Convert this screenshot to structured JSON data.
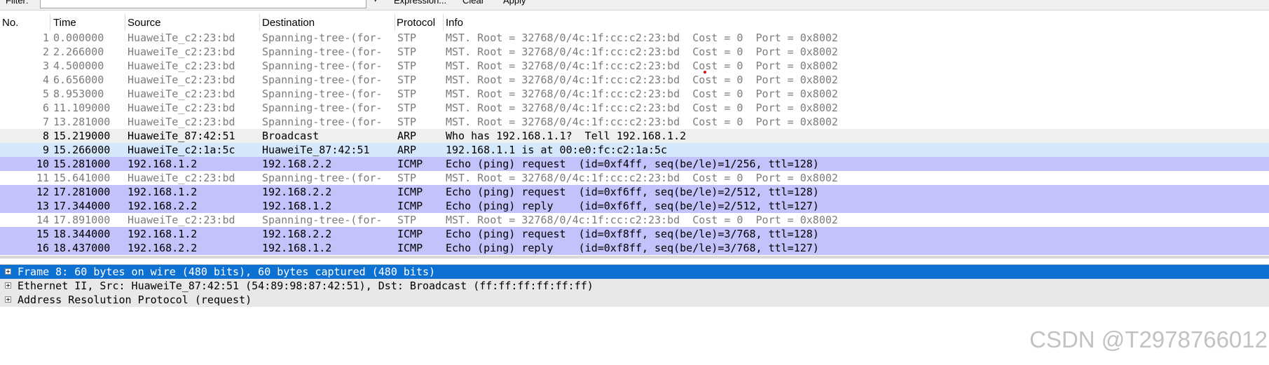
{
  "filter": {
    "label": "Filter:",
    "value": "",
    "expression_label": "Expression...",
    "clear_label": "Clear",
    "apply_label": "Apply"
  },
  "columns": [
    "No.",
    "Time",
    "Source",
    "Destination",
    "Protocol",
    "Info"
  ],
  "packets": [
    {
      "no": "1",
      "time": "0.000000",
      "source": "HuaweiTe_c2:23:bd",
      "destination": "Spanning-tree-(for-",
      "protocol": "STP",
      "info": "MST. Root = 32768/0/4c:1f:cc:c2:23:bd  Cost = 0  Port = 0x8002",
      "kind": "stp"
    },
    {
      "no": "2",
      "time": "2.266000",
      "source": "HuaweiTe_c2:23:bd",
      "destination": "Spanning-tree-(for-",
      "protocol": "STP",
      "info": "MST. Root = 32768/0/4c:1f:cc:c2:23:bd  Cost = 0  Port = 0x8002",
      "kind": "stp"
    },
    {
      "no": "3",
      "time": "4.500000",
      "source": "HuaweiTe_c2:23:bd",
      "destination": "Spanning-tree-(for-",
      "protocol": "STP",
      "info": "MST. Root = 32768/0/4c:1f:cc:c2:23:bd  Cost = 0  Port = 0x8002",
      "kind": "stp"
    },
    {
      "no": "4",
      "time": "6.656000",
      "source": "HuaweiTe_c2:23:bd",
      "destination": "Spanning-tree-(for-",
      "protocol": "STP",
      "info": "MST. Root = 32768/0/4c:1f:cc:c2:23:bd  Cost = 0  Port = 0x8002",
      "kind": "stp"
    },
    {
      "no": "5",
      "time": "8.953000",
      "source": "HuaweiTe_c2:23:bd",
      "destination": "Spanning-tree-(for-",
      "protocol": "STP",
      "info": "MST. Root = 32768/0/4c:1f:cc:c2:23:bd  Cost = 0  Port = 0x8002",
      "kind": "stp"
    },
    {
      "no": "6",
      "time": "11.109000",
      "source": "HuaweiTe_c2:23:bd",
      "destination": "Spanning-tree-(for-",
      "protocol": "STP",
      "info": "MST. Root = 32768/0/4c:1f:cc:c2:23:bd  Cost = 0  Port = 0x8002",
      "kind": "stp"
    },
    {
      "no": "7",
      "time": "13.281000",
      "source": "HuaweiTe_c2:23:bd",
      "destination": "Spanning-tree-(for-",
      "protocol": "STP",
      "info": "MST. Root = 32768/0/4c:1f:cc:c2:23:bd  Cost = 0  Port = 0x8002",
      "kind": "stp"
    },
    {
      "no": "8",
      "time": "15.219000",
      "source": "HuaweiTe_87:42:51",
      "destination": "Broadcast",
      "protocol": "ARP",
      "info": "Who has 192.168.1.1?  Tell 192.168.1.2",
      "kind": "arp"
    },
    {
      "no": "9",
      "time": "15.266000",
      "source": "HuaweiTe_c2:1a:5c",
      "destination": "HuaweiTe_87:42:51",
      "protocol": "ARP",
      "info": "192.168.1.1 is at 00:e0:fc:c2:1a:5c",
      "kind": "arp2"
    },
    {
      "no": "10",
      "time": "15.281000",
      "source": "192.168.1.2",
      "destination": "192.168.2.2",
      "protocol": "ICMP",
      "info": "Echo (ping) request  (id=0xf4ff, seq(be/le)=1/256, ttl=128)",
      "kind": "icmp"
    },
    {
      "no": "11",
      "time": "15.641000",
      "source": "HuaweiTe_c2:23:bd",
      "destination": "Spanning-tree-(for-",
      "protocol": "STP",
      "info": "MST. Root = 32768/0/4c:1f:cc:c2:23:bd  Cost = 0  Port = 0x8002",
      "kind": "stp"
    },
    {
      "no": "12",
      "time": "17.281000",
      "source": "192.168.1.2",
      "destination": "192.168.2.2",
      "protocol": "ICMP",
      "info": "Echo (ping) request  (id=0xf6ff, seq(be/le)=2/512, ttl=128)",
      "kind": "icmp"
    },
    {
      "no": "13",
      "time": "17.344000",
      "source": "192.168.2.2",
      "destination": "192.168.1.2",
      "protocol": "ICMP",
      "info": "Echo (ping) reply    (id=0xf6ff, seq(be/le)=2/512, ttl=127)",
      "kind": "icmp"
    },
    {
      "no": "14",
      "time": "17.891000",
      "source": "HuaweiTe_c2:23:bd",
      "destination": "Spanning-tree-(for-",
      "protocol": "STP",
      "info": "MST. Root = 32768/0/4c:1f:cc:c2:23:bd  Cost = 0  Port = 0x8002",
      "kind": "stp"
    },
    {
      "no": "15",
      "time": "18.344000",
      "source": "192.168.1.2",
      "destination": "192.168.2.2",
      "protocol": "ICMP",
      "info": "Echo (ping) request  (id=0xf8ff, seq(be/le)=3/768, ttl=128)",
      "kind": "icmp"
    },
    {
      "no": "16",
      "time": "18.437000",
      "source": "192.168.2.2",
      "destination": "192.168.1.2",
      "protocol": "ICMP",
      "info": "Echo (ping) reply    (id=0xf8ff, seq(be/le)=3/768, ttl=127)",
      "kind": "icmp"
    }
  ],
  "details": [
    {
      "text": "Frame 8: 60 bytes on wire (480 bits), 60 bytes captured (480 bits)",
      "selected": true
    },
    {
      "text": "Ethernet II, Src: HuaweiTe_87:42:51 (54:89:98:87:42:51), Dst: Broadcast (ff:ff:ff:ff:ff:ff)",
      "selected": false
    },
    {
      "text": "Address Resolution Protocol (request)",
      "selected": false
    }
  ],
  "watermark": "CSDN @T2978766012",
  "colors": {
    "stp_bg": "#ffffff",
    "stp_fg": "#7c7c7c",
    "arp_bg": "#efefef",
    "arp_reply_bg": "#d5e7fb",
    "icmp_bg": "#c3c2fb",
    "detail_selected_bg": "#0c71d2"
  },
  "icons": {
    "expander": "plus-box-icon"
  }
}
